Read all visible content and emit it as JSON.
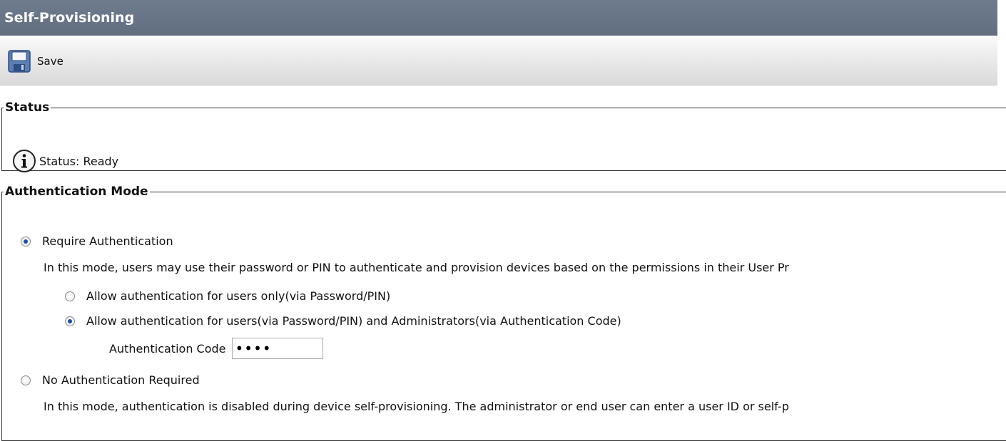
{
  "header": {
    "title": "Self-Provisioning"
  },
  "toolbar": {
    "save_label": "Save",
    "save_icon": "floppy-disk-icon"
  },
  "status": {
    "legend": "Status",
    "icon": "info-icon",
    "text": "Status: Ready"
  },
  "auth": {
    "legend": "Authentication Mode",
    "require": {
      "label": "Require Authentication",
      "checked": true,
      "description": "In this mode, users may use their password or PIN to authenticate and provision devices based on the permissions in their User Pr"
    },
    "users_only": {
      "label": "Allow authentication for users only(via Password/PIN)",
      "checked": false
    },
    "users_admins": {
      "label": "Allow authentication for users(via Password/PIN) and Administrators(via Authentication Code)",
      "checked": true
    },
    "code": {
      "label": "Authentication Code",
      "value": "••••"
    },
    "no_auth": {
      "label": "No Authentication Required",
      "checked": false,
      "description": "In this mode, authentication is disabled during device self-provisioning. The administrator or end user can enter a user ID or self-p"
    }
  },
  "colors": {
    "titlebar": "#6a7789",
    "radio_selected": "#1c4ea6"
  }
}
